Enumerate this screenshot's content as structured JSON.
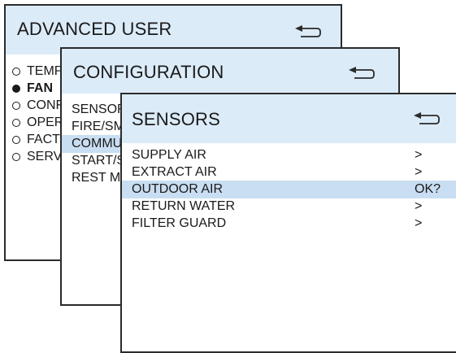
{
  "advanced_user": {
    "title": "ADVANCED USER",
    "back_icon": "back-arrow-icon",
    "items": [
      {
        "label": "TEMPERATURE",
        "selected": false
      },
      {
        "label": "FAN",
        "selected": true
      },
      {
        "label": "CONFIGURATION",
        "selected": false
      },
      {
        "label": "OPERATION",
        "selected": false
      },
      {
        "label": "FACTORY",
        "selected": false
      },
      {
        "label": "SERVICE",
        "selected": false
      }
    ]
  },
  "configuration": {
    "title": "CONFIGURATION",
    "back_icon": "back-arrow-icon",
    "items": [
      {
        "label": "SENSORS"
      },
      {
        "label": "FIRE/SMOKE"
      },
      {
        "label": "COMMUNICATION",
        "highlighted": true
      },
      {
        "label": "START/STOP"
      },
      {
        "label": "REST MODE"
      }
    ]
  },
  "sensors": {
    "title": "SENSORS",
    "back_icon": "back-arrow-icon",
    "items": [
      {
        "label": "SUPPLY AIR",
        "value": ">"
      },
      {
        "label": "EXTRACT AIR",
        "value": ">"
      },
      {
        "label": "OUTDOOR AIR",
        "value": "OK?",
        "highlighted": true
      },
      {
        "label": "RETURN WATER",
        "value": ">"
      },
      {
        "label": "FILTER GUARD",
        "value": ">"
      }
    ]
  },
  "colors": {
    "header_bg": "#dcebf8",
    "highlight_bg": "#c9def2",
    "border": "#2b2b2b",
    "text": "#1a1a1a"
  }
}
